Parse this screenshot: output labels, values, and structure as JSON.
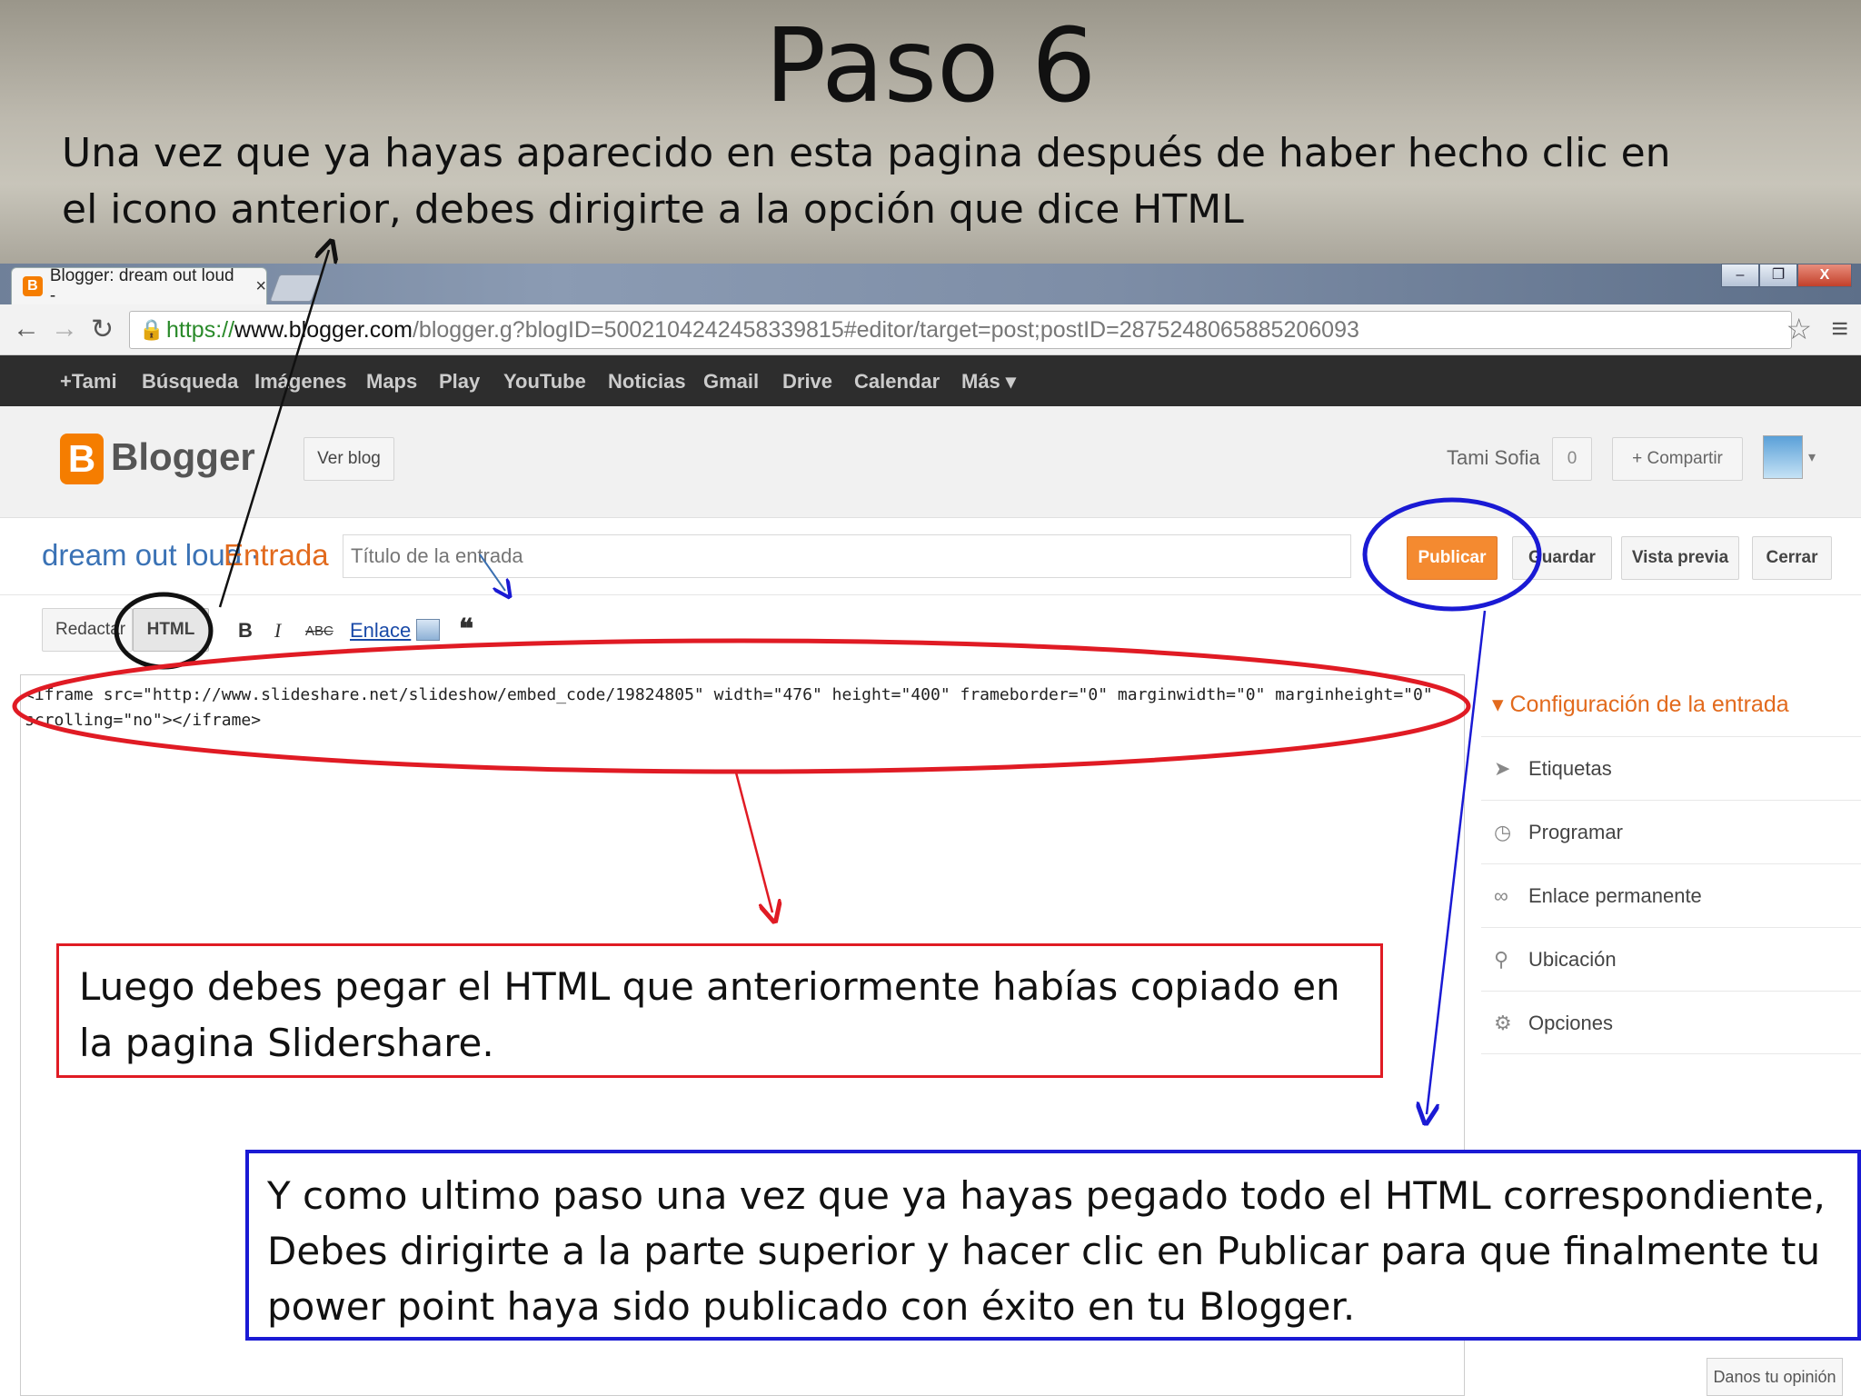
{
  "slide": {
    "title": "Paso 6",
    "intro": "Una vez que ya hayas aparecido en esta pagina después de haber hecho clic en el icono anterior, debes dirigirte a la opción que dice HTML",
    "callout_paste": "Luego debes pegar el HTML que anteriormente habías copiado en la pagina Slidershare.",
    "callout_publish": "Y como ultimo paso una vez que ya hayas pegado todo el HTML correspondiente, Debes dirigirte a la parte superior y hacer clic en Publicar para que finalmente tu power point haya sido  publicado con éxito en tu Blogger."
  },
  "browser": {
    "tab_title": "Blogger: dream out loud -",
    "tab_close": "×",
    "url_scheme": "https://",
    "url_host": "www.blogger.com",
    "url_path": "/blogger.g?blogID=5002104242458339815#editor/target=post;postID=2875248065885206093",
    "window_buttons": [
      "–",
      "❐",
      "X"
    ]
  },
  "gbar": {
    "items": [
      "+Tami",
      "Búsqueda",
      "Imágenes",
      "Maps",
      "Play",
      "YouTube",
      "Noticias",
      "Gmail",
      "Drive",
      "Calendar",
      "Más ▾"
    ]
  },
  "blogger": {
    "brand": "Blogger",
    "logo_letter": "B",
    "view_blog": "Ver blog",
    "user_name": "Tami Sofia",
    "notifications": "0",
    "share": "+ Compartir"
  },
  "post": {
    "blog_name": "dream out loud ·",
    "entry_label": "Entrada",
    "title_placeholder": "Título de la entrada",
    "publish": "Publicar",
    "save": "Guardar",
    "preview": "Vista previa",
    "close": "Cerrar"
  },
  "compose": {
    "tab_compose": "Redactar",
    "tab_html": "HTML",
    "bold": "B",
    "italic": "I",
    "strike": "ABC",
    "link": "Enlace",
    "quote": "❝"
  },
  "editor": {
    "content": "<iframe src=\"http://www.slideshare.net/slideshow/embed_code/19824805\" width=\"476\" height=\"400\" frameborder=\"0\" marginwidth=\"0\" marginheight=\"0\" scrolling=\"no\"></iframe>"
  },
  "settings": {
    "heading": "▾ Configuración de la entrada",
    "items": [
      {
        "icon": "tag-icon",
        "label": "Etiquetas"
      },
      {
        "icon": "clock-icon",
        "label": "Programar"
      },
      {
        "icon": "link-icon",
        "label": "Enlace permanente"
      },
      {
        "icon": "pin-icon",
        "label": "Ubicación"
      },
      {
        "icon": "gear-icon",
        "label": "Opciones"
      }
    ],
    "feedback": "Danos tu opinión"
  },
  "colors": {
    "annotation_red": "#e01b24",
    "annotation_blue": "#1a1ad4",
    "blogger_orange": "#f57d00",
    "blog_link_blue": "#3a72b5"
  }
}
